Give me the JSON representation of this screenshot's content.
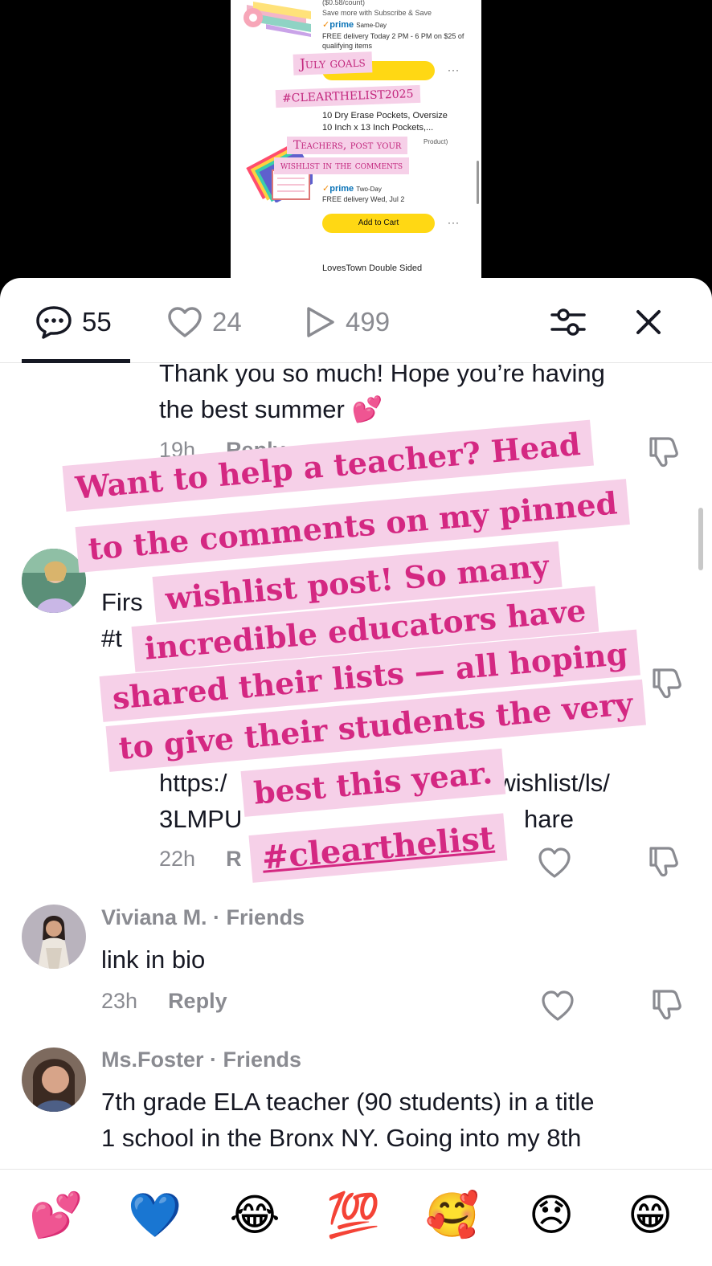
{
  "video": {
    "price_count": "($0.58/count)",
    "subscribe_text": "Save more with Subscribe & Save",
    "prime_1": "prime",
    "prime_1_type": "Same-Day",
    "delivery_1": "FREE delivery Today 2 PM - 6 PM on $25 of",
    "qualifying": "qualifying items",
    "product_line_1": "10 Dry Erase Pockets, Oversize",
    "product_line_2": "10 Inch x 13 Inch Pockets,...",
    "product_tag": "Product)",
    "prime_2": "prime",
    "prime_2_type": "Two-Day",
    "delivery_2": "FREE delivery Wed, Jul 2",
    "add_to_cart": "Add to Cart",
    "more": "···",
    "next_product": "LovesTown Double Sided",
    "stickers": {
      "july_goals": "July goals",
      "hashtag": "#CLEARTHELIST2025",
      "teachers_1": "Teachers, post your",
      "teachers_2": "wishlist in the comments"
    }
  },
  "tabs": {
    "comments_count": "55",
    "likes_count": "24",
    "views_count": "499"
  },
  "comments": [
    {
      "text_lines": [
        "Thank you so much! Hope you’re having",
        "the best summer 💕"
      ],
      "time": "19h",
      "reply": "Reply"
    },
    {
      "text_lines": [
        "Firs",
        "#t",
        "https:/",
        "3LMPU"
      ],
      "link_right": "nz/wishlist/ls/",
      "share_right": "hare",
      "time": "22h",
      "reply": "R"
    },
    {
      "name": "Viviana M. · Friends",
      "text_lines": [
        "link in bio"
      ],
      "time": "23h",
      "reply": "Reply"
    },
    {
      "name": "Ms.Foster · Friends",
      "text_lines": [
        "7th grade ELA teacher (90 students) in a title",
        "1 school in the Bronx NY. Going into my 8th"
      ]
    }
  ],
  "overlay": {
    "lines": [
      "Want to help a teacher? Head",
      "to the comments on my pinned",
      "wishlist post! So many",
      "incredible educators have",
      "shared their lists — all hoping",
      "to give their students the very",
      "best this year."
    ],
    "hashtag": "#clearthelist"
  },
  "emojis": [
    "💕",
    "💙",
    "😂",
    "💯",
    "🥰",
    "😞",
    "😁"
  ],
  "colors": {
    "overlay_bg": "#f6d0e8",
    "overlay_text": "#d42882",
    "prime_blue": "#0a73b7",
    "cart_yellow": "#ffd814"
  }
}
